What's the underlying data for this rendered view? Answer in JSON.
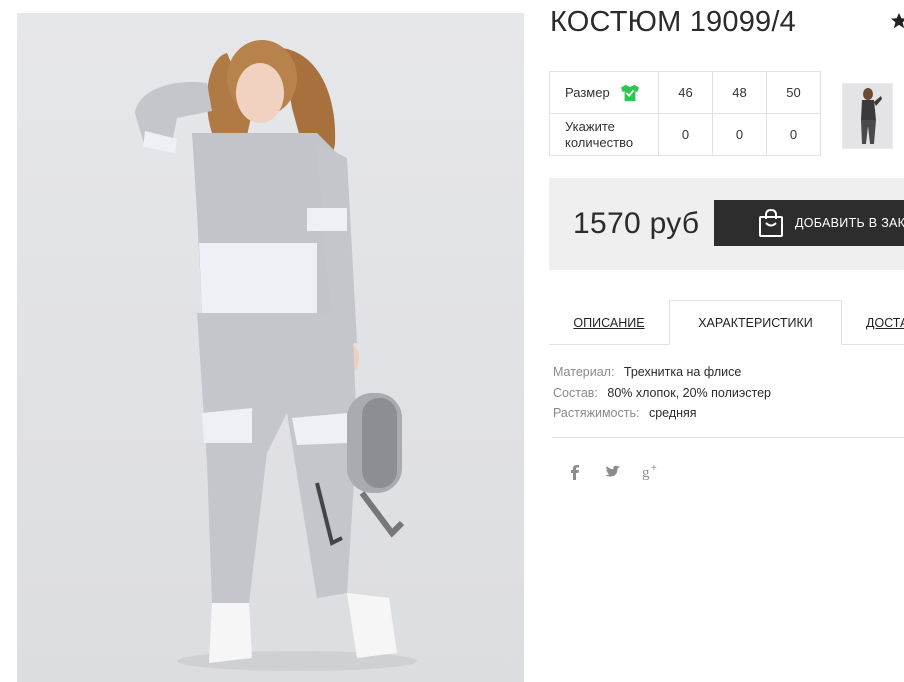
{
  "product": {
    "title": "КОСТЮМ 19099/4"
  },
  "size_table": {
    "size_label": "Размер",
    "quantity_label_line1": "Укажите",
    "quantity_label_line2": "количество",
    "sizes": [
      "46",
      "48",
      "50"
    ],
    "quantities": [
      "0",
      "0",
      "0"
    ]
  },
  "price": {
    "amount": "1570 руб",
    "order_button": "ДОБАВИТЬ В ЗАКАЗ"
  },
  "tabs": [
    {
      "label": "ОПИСАНИЕ",
      "active": false
    },
    {
      "label": "ХАРАКТЕРИСТИКИ",
      "active": true
    },
    {
      "label": "ДОСТАВКА",
      "active": false
    }
  ],
  "specs": [
    {
      "key": "Материал:",
      "value": "Трехнитка на флисе"
    },
    {
      "key": "Состав:",
      "value": "80% хлопок, 20% полиэстер"
    },
    {
      "key": "Растяжимость:",
      "value": "средняя"
    }
  ],
  "social": [
    "facebook-icon",
    "twitter-icon",
    "google-plus-icon"
  ],
  "colors": {
    "accent_green": "#2fc552",
    "button_dark": "#2d2d2d",
    "price_bg": "#efefef"
  }
}
